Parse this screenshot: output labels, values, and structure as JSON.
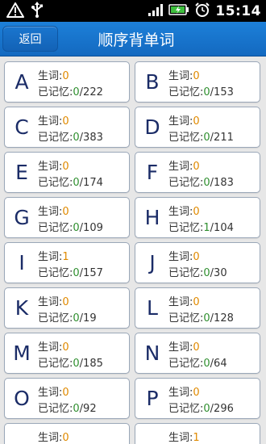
{
  "status_bar": {
    "time": "15:14",
    "icons": [
      "warning-icon",
      "usb-icon",
      "signal-icon",
      "battery-charging-icon",
      "alarm-clock-icon"
    ]
  },
  "header": {
    "back_label": "返回",
    "title": "顺序背单词"
  },
  "labels": {
    "new_words": "生词:",
    "memorized": "已记忆:"
  },
  "colors": {
    "new_count": "#e08a00",
    "memorized_count": "#2f8f2f",
    "header_blue": "#1976d2"
  },
  "cards": [
    {
      "letter": "A",
      "new": "0",
      "memorized": "0",
      "total": "/222"
    },
    {
      "letter": "B",
      "new": "0",
      "memorized": "0",
      "total": "/153"
    },
    {
      "letter": "C",
      "new": "0",
      "memorized": "0",
      "total": "/383"
    },
    {
      "letter": "D",
      "new": "0",
      "memorized": "0",
      "total": "/211"
    },
    {
      "letter": "E",
      "new": "0",
      "memorized": "0",
      "total": "/174"
    },
    {
      "letter": "F",
      "new": "0",
      "memorized": "0",
      "total": "/183"
    },
    {
      "letter": "G",
      "new": "0",
      "memorized": "0",
      "total": "/109"
    },
    {
      "letter": "H",
      "new": "0",
      "memorized": "1",
      "total": "/104"
    },
    {
      "letter": "I",
      "new": "1",
      "memorized": "0",
      "total": "/157"
    },
    {
      "letter": "J",
      "new": "0",
      "memorized": "0",
      "total": "/30"
    },
    {
      "letter": "K",
      "new": "0",
      "memorized": "0",
      "total": "/19"
    },
    {
      "letter": "L",
      "new": "0",
      "memorized": "0",
      "total": "/128"
    },
    {
      "letter": "M",
      "new": "0",
      "memorized": "0",
      "total": "/185"
    },
    {
      "letter": "N",
      "new": "0",
      "memorized": "0",
      "total": "/64"
    },
    {
      "letter": "O",
      "new": "0",
      "memorized": "0",
      "total": "/92"
    },
    {
      "letter": "P",
      "new": "0",
      "memorized": "0",
      "total": "/296"
    },
    {
      "letter": "",
      "new": "0",
      "memorized": "",
      "total": ""
    },
    {
      "letter": "",
      "new": "1",
      "memorized": "",
      "total": ""
    }
  ]
}
